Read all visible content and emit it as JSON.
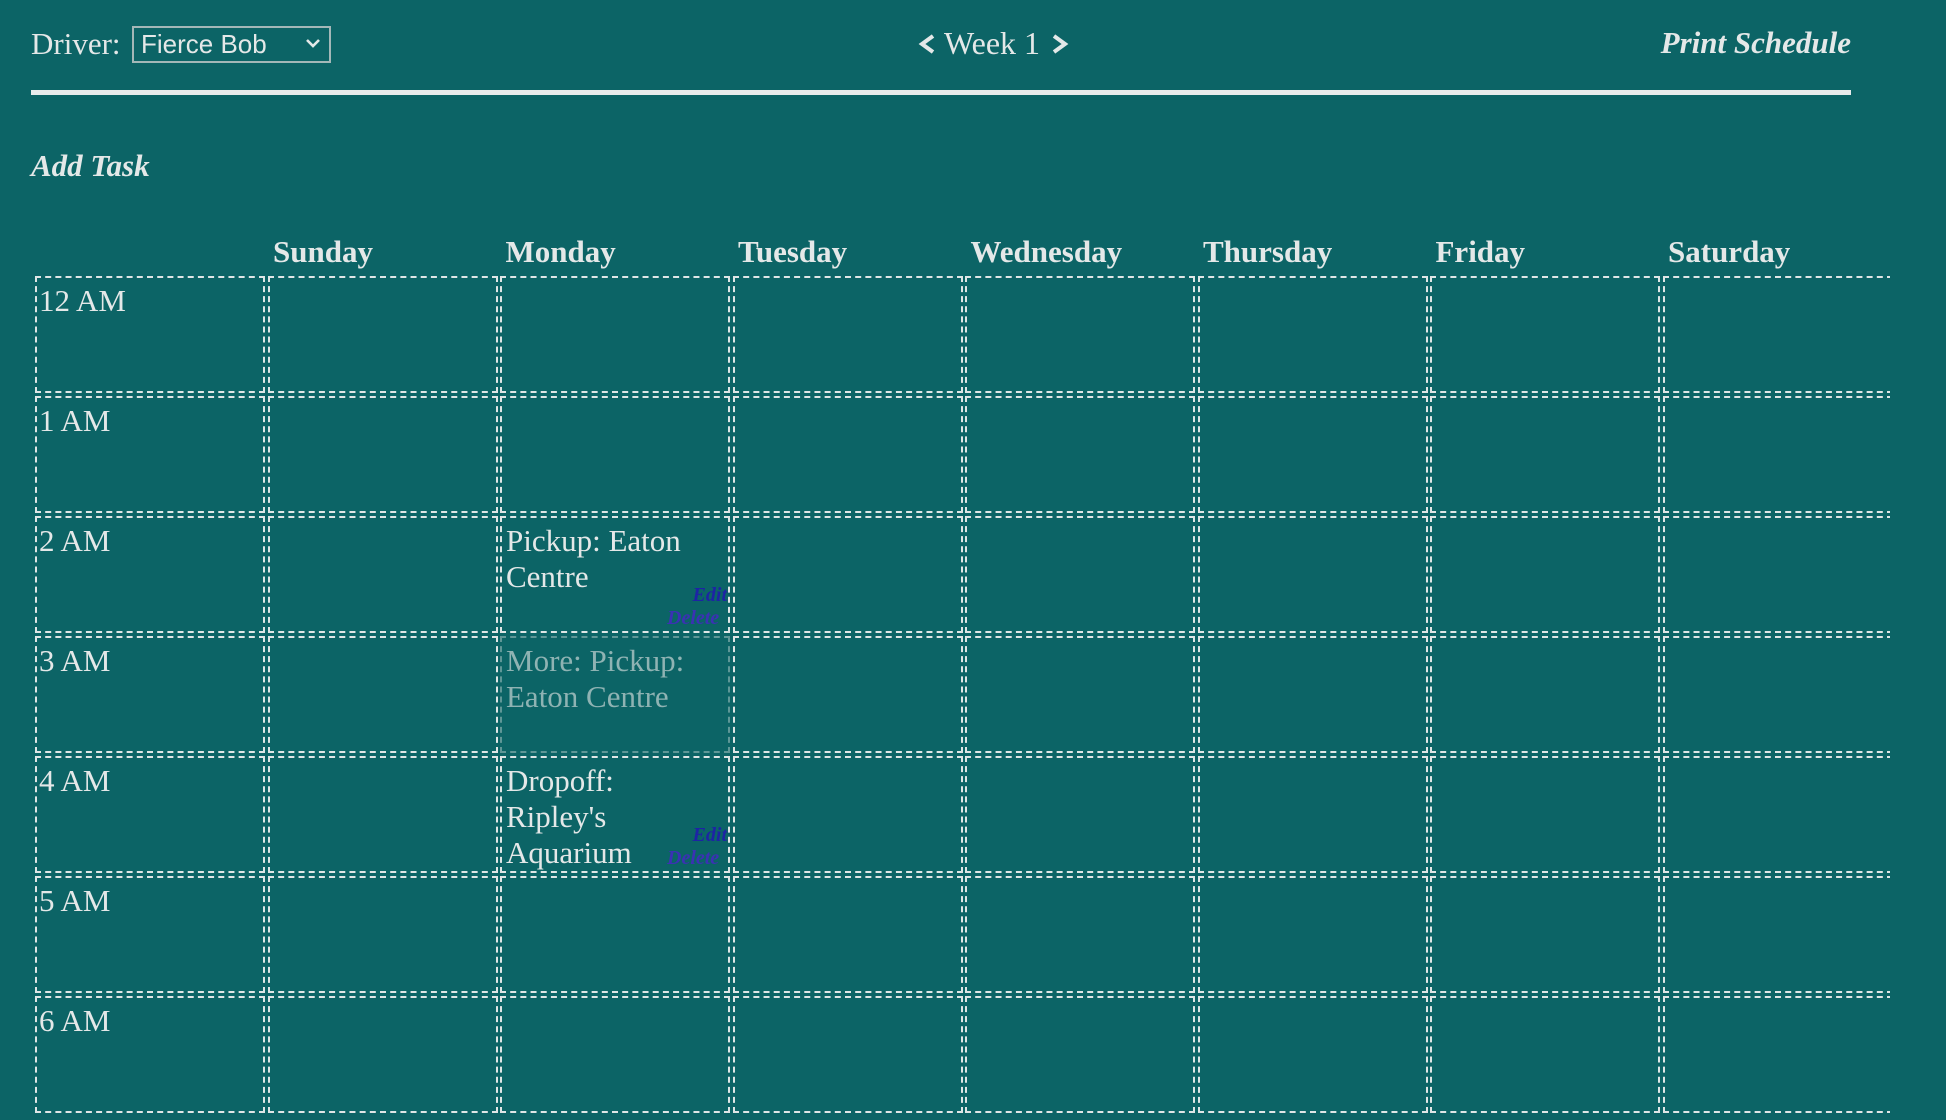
{
  "toolbar": {
    "driver_label": "Driver:",
    "driver_selected": "Fierce Bob",
    "week_label": "Week 1",
    "print_label": "Print Schedule"
  },
  "add_task_label": "Add Task",
  "days": [
    "Sunday",
    "Monday",
    "Tuesday",
    "Wednesday",
    "Thursday",
    "Friday",
    "Saturday"
  ],
  "hours": [
    "12 AM",
    "1 AM",
    "2 AM",
    "3 AM",
    "4 AM",
    "5 AM",
    "6 AM"
  ],
  "tasks": [
    {
      "day": "Monday",
      "hour": "2 AM",
      "text": "Pickup: Eaton Centre",
      "edit_label": "Edit",
      "delete_label": "Delete"
    },
    {
      "day": "Monday",
      "hour": "3 AM",
      "text": "More: Pickup: Eaton Centre",
      "continuation": true
    },
    {
      "day": "Monday",
      "hour": "4 AM",
      "text": "Dropoff: Ripley's Aquarium",
      "edit_label": "Edit",
      "delete_label": "Delete"
    }
  ],
  "colors": {
    "background": "#0c6466",
    "text": "#e4e8e8",
    "edit_link": "#1d24a4",
    "delete_link": "#3b31b4",
    "continuation_text": "#8fb3b3"
  },
  "icons": {
    "driver_dropdown": "chevron-down-icon",
    "prev_week": "chevron-left-icon",
    "next_week": "chevron-right-icon"
  }
}
